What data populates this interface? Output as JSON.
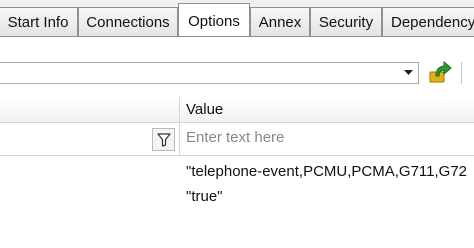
{
  "tabs": [
    {
      "label": "Start Info",
      "active": false
    },
    {
      "label": "Connections",
      "active": false
    },
    {
      "label": "Options",
      "active": true
    },
    {
      "label": "Annex",
      "active": false
    },
    {
      "label": "Security",
      "active": false
    },
    {
      "label": "Dependency",
      "active": false
    }
  ],
  "toolbar": {
    "combo_value": "",
    "go_icon": "go-arrow-icon"
  },
  "grid": {
    "value_header": "Value",
    "filter_placeholder": "Enter text here",
    "rows": [
      {
        "value": "\"telephone-event,PCMU,PCMA,G711,G72"
      },
      {
        "value": "\"true\""
      }
    ]
  },
  "colors": {
    "tab_border": "#8e8f8f",
    "grid_line": "#d5d5d5",
    "go_icon_green": "#2e9a2e",
    "go_icon_gold": "#e8b010"
  }
}
